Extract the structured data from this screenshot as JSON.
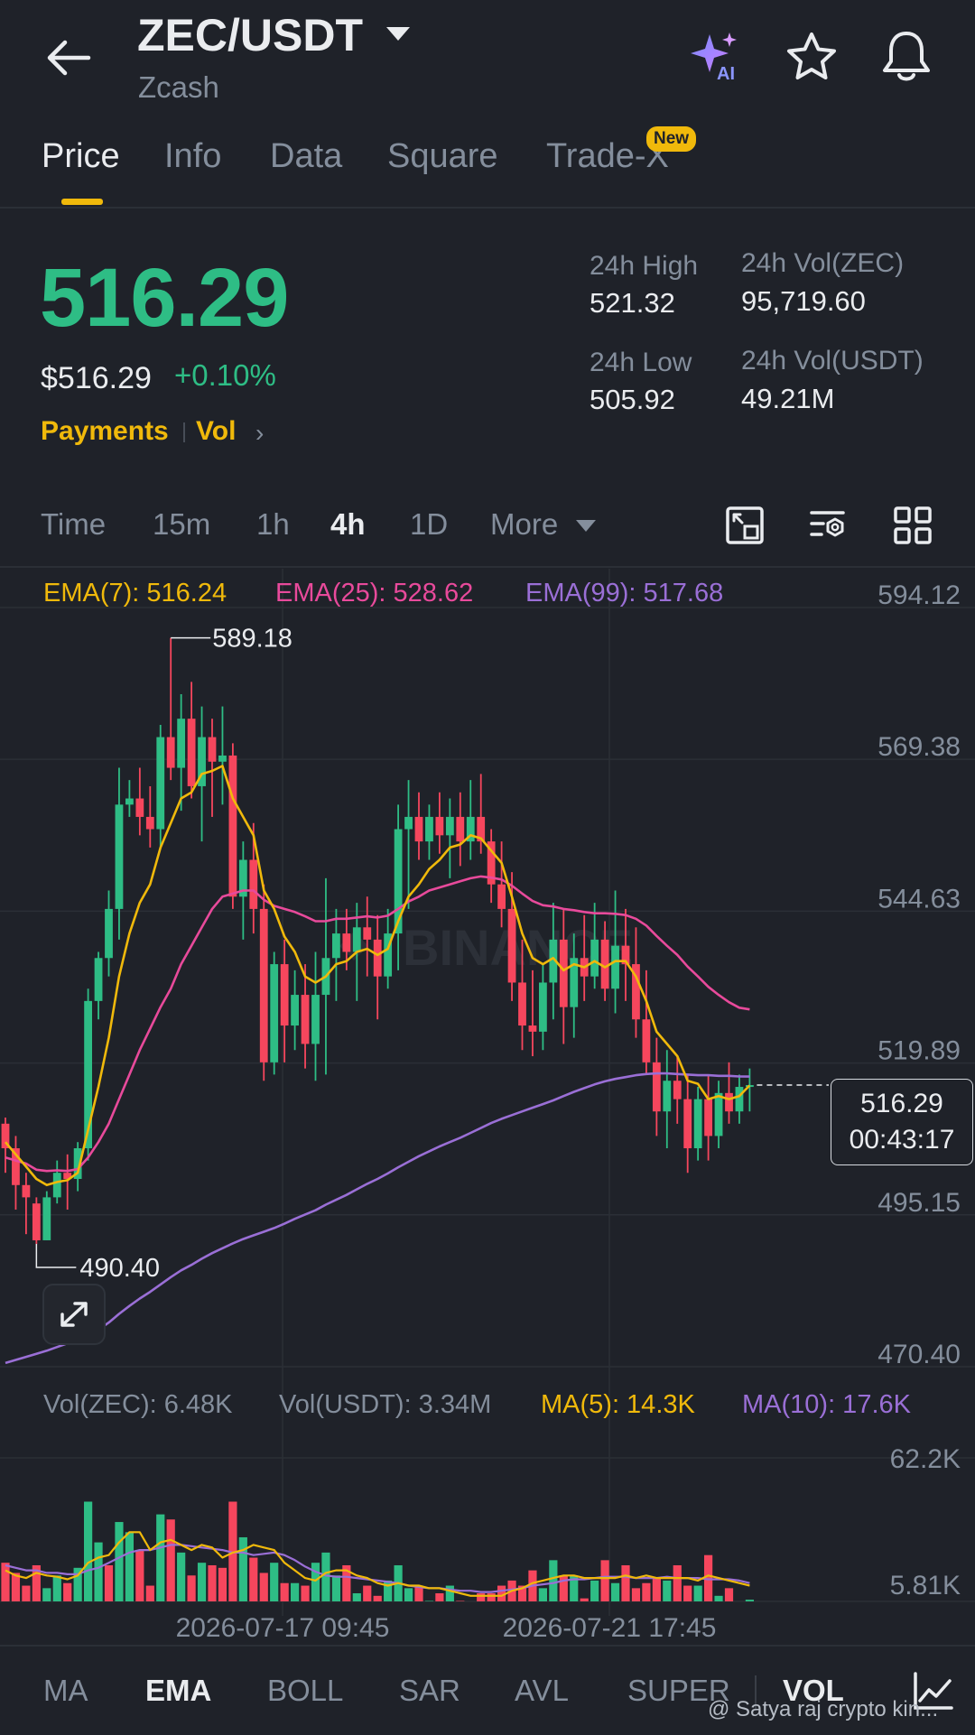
{
  "header": {
    "pair": "ZEC/USDT",
    "name": "Zcash",
    "icons": [
      "back-arrow-icon",
      "ai-sparkle-icon",
      "star-icon",
      "bell-icon"
    ]
  },
  "tabs": {
    "items": [
      "Price",
      "Info",
      "Data",
      "Square",
      "Trade-X"
    ],
    "active": "Price",
    "new_badge": "New"
  },
  "ticker": {
    "last_price": "516.29",
    "usd_price": "$516.29",
    "change_pct": "+0.10%",
    "tags": [
      "Payments",
      "Vol"
    ],
    "stats": {
      "high_label": "24h High",
      "high": "521.32",
      "low_label": "24h Low",
      "low": "505.92",
      "vol_base_label": "24h Vol(ZEC)",
      "vol_base": "95,719.60",
      "vol_quote_label": "24h Vol(USDT)",
      "vol_quote": "49.21M"
    }
  },
  "intervals": {
    "items": [
      "Time",
      "15m",
      "1h",
      "4h",
      "1D",
      "More"
    ],
    "active": "4h",
    "tools": [
      "fullscreen-icon",
      "chart-settings-icon",
      "layout-grid-icon"
    ]
  },
  "ema_legend": {
    "ema7": "EMA(7): 516.24",
    "ema25": "EMA(25): 528.62",
    "ema99": "EMA(99): 517.68"
  },
  "volume_legend": {
    "vol_base": "Vol(ZEC): 6.48K",
    "vol_quote": "Vol(USDT): 3.34M",
    "ma5": "MA(5): 14.3K",
    "ma10": "MA(10): 17.6K"
  },
  "price_box": {
    "value": "516.29",
    "countdown": "00:43:17"
  },
  "chart_data": {
    "type": "candlestick",
    "interval": "4h",
    "price_axis_ticks": [
      "594.12",
      "569.38",
      "544.63",
      "519.89",
      "495.15",
      "470.40"
    ],
    "volume_axis_ticks": [
      "62.2K",
      "5.81K"
    ],
    "time_axis_ticks": [
      "2026-07-17 09:45",
      "2026-07-21 17:45"
    ],
    "high_annotation": "589.18",
    "low_annotation": "490.40",
    "ylim": [
      470.4,
      594.12
    ],
    "volume_ylim": [
      5.81,
      62.2
    ],
    "volume_unit": "K",
    "watermark": "BINANCE",
    "colors": {
      "up": "#2ebd85",
      "down": "#f6465d",
      "ema7": "#f0b90b",
      "ema25": "#e84a9b",
      "ema99": "#9a6fd6",
      "vol_ma5": "#f0b90b",
      "vol_ma10": "#9a6fd6"
    },
    "candles": [
      [
        510,
        511,
        502,
        506
      ],
      [
        506,
        508,
        496,
        500
      ],
      [
        500,
        502,
        492,
        498
      ],
      [
        497,
        498,
        490.4,
        491
      ],
      [
        491,
        499,
        491,
        498
      ],
      [
        498,
        504,
        497,
        502
      ],
      [
        502,
        505,
        496,
        501
      ],
      [
        501,
        507,
        499,
        506
      ],
      [
        506,
        532,
        504,
        530
      ],
      [
        530,
        538,
        527,
        537
      ],
      [
        537,
        548,
        534,
        545
      ],
      [
        545,
        568,
        540,
        562
      ],
      [
        562,
        566,
        560,
        563
      ],
      [
        563,
        568,
        557,
        560
      ],
      [
        560,
        565,
        555,
        558
      ],
      [
        558,
        575,
        555,
        573
      ],
      [
        573,
        589.18,
        566,
        568
      ],
      [
        568,
        580,
        561,
        576
      ],
      [
        576,
        582,
        563,
        565
      ],
      [
        565,
        578,
        556,
        573
      ],
      [
        573,
        576,
        560,
        569
      ],
      [
        569,
        578,
        562,
        570
      ],
      [
        570,
        572,
        545,
        547
      ],
      [
        547,
        556,
        540,
        553
      ],
      [
        553,
        559,
        541,
        545
      ],
      [
        545,
        549,
        517,
        520
      ],
      [
        520,
        538,
        518,
        536
      ],
      [
        536,
        540,
        520,
        526
      ],
      [
        526,
        535,
        522,
        531
      ],
      [
        531,
        536,
        519,
        523
      ],
      [
        523,
        538,
        517,
        531
      ],
      [
        531,
        550,
        518,
        537
      ],
      [
        537,
        545,
        530,
        541
      ],
      [
        541,
        545,
        535,
        538
      ],
      [
        538,
        546,
        530,
        542
      ],
      [
        542,
        547,
        534,
        540
      ],
      [
        540,
        544,
        527,
        534
      ],
      [
        534,
        545,
        532,
        541
      ],
      [
        541,
        562,
        535,
        558
      ],
      [
        558,
        566,
        545,
        560
      ],
      [
        560,
        564,
        553,
        556
      ],
      [
        556,
        562,
        553,
        560
      ],
      [
        560,
        564,
        554,
        557
      ],
      [
        557,
        563,
        550,
        560
      ],
      [
        560,
        564,
        552,
        556
      ],
      [
        556,
        566,
        553,
        560
      ],
      [
        560,
        567,
        554,
        556
      ],
      [
        556,
        558,
        546,
        549
      ],
      [
        549,
        556,
        542,
        545
      ],
      [
        545,
        551,
        530,
        533
      ],
      [
        533,
        540,
        522,
        526
      ],
      [
        526,
        535,
        521,
        525
      ],
      [
        525,
        536,
        522,
        533
      ],
      [
        533,
        546,
        527,
        540
      ],
      [
        540,
        545,
        523,
        529
      ],
      [
        529,
        541,
        524,
        537
      ],
      [
        537,
        544,
        530,
        534
      ],
      [
        534,
        546,
        532,
        540
      ],
      [
        540,
        543,
        530,
        532
      ],
      [
        532,
        548,
        528,
        539
      ],
      [
        539,
        545,
        530,
        536
      ],
      [
        536,
        542,
        524,
        527
      ],
      [
        527,
        535,
        518,
        520
      ],
      [
        520,
        524,
        508,
        512
      ],
      [
        512,
        522,
        506,
        517
      ],
      [
        517,
        521,
        510,
        514
      ],
      [
        514,
        518,
        502,
        506
      ],
      [
        506,
        516,
        504,
        514
      ],
      [
        514,
        518,
        504,
        508
      ],
      [
        508,
        517,
        506,
        515
      ],
      [
        515,
        520,
        510,
        512
      ],
      [
        512,
        518,
        510,
        516
      ],
      [
        516,
        519,
        512,
        516.29
      ]
    ],
    "ema7": [
      507,
      505,
      503,
      501,
      500,
      500.5,
      500.8,
      502,
      509,
      516,
      524,
      534,
      541,
      546,
      549,
      555,
      559,
      563,
      564,
      567,
      567.5,
      568.3,
      563,
      560,
      557,
      548,
      545,
      540.5,
      538,
      534,
      533,
      534,
      536,
      536.5,
      538,
      538.5,
      537.5,
      538.5,
      543,
      547,
      549,
      551.5,
      553,
      555,
      555.5,
      557,
      556.5,
      554.5,
      552.5,
      547,
      541,
      537,
      536,
      537,
      535,
      536,
      535.5,
      536.5,
      535.5,
      536.5,
      536.5,
      534,
      530,
      525,
      523,
      521,
      517,
      516.5,
      514,
      514.5,
      514,
      514.5,
      516.24
    ],
    "ema25": [
      504.5,
      504,
      503.5,
      502.5,
      502.3,
      502.4,
      502.3,
      502.6,
      504.5,
      507,
      510,
      514,
      518,
      522,
      525.5,
      529,
      532,
      536,
      539,
      542,
      545,
      547,
      547.5,
      548,
      548,
      546.5,
      545.5,
      545,
      544.5,
      543.8,
      543,
      543,
      543.4,
      543.4,
      543.6,
      543.8,
      543.6,
      543.9,
      545,
      546.2,
      547,
      548,
      548.5,
      549,
      549.5,
      550,
      550.3,
      550.1,
      549.8,
      548.8,
      547.5,
      546.3,
      545.6,
      545.4,
      545,
      544.8,
      544.5,
      544.3,
      544.3,
      544.2,
      544,
      543.4,
      542.3,
      540.6,
      539,
      537.5,
      535.6,
      534,
      532.3,
      531,
      529.8,
      528.9,
      528.62
    ],
    "ema99": [
      471,
      471.5,
      472,
      472.5,
      473,
      473.6,
      474.2,
      474.8,
      475.6,
      476.4,
      477.6,
      479,
      480.3,
      481.5,
      482.6,
      483.8,
      485,
      486.1,
      487,
      488,
      488.9,
      489.7,
      490.5,
      491.2,
      491.8,
      492.4,
      493,
      493.7,
      494.5,
      495.2,
      495.9,
      496.8,
      497.6,
      498.4,
      499.3,
      500.2,
      501,
      501.9,
      502.9,
      503.8,
      504.7,
      505.5,
      506.3,
      507,
      507.7,
      508.5,
      509.3,
      510.1,
      510.8,
      511.4,
      512,
      512.6,
      513.2,
      513.8,
      514.5,
      515.2,
      515.8,
      516.4,
      516.9,
      517.3,
      517.6,
      517.9,
      518.1,
      518.2,
      518.2,
      518.1,
      518,
      517.9,
      517.9,
      517.8,
      517.8,
      517.7,
      517.68
    ],
    "volume": [
      21,
      17,
      12,
      20,
      11,
      16,
      13,
      19,
      45,
      29,
      20,
      37,
      33,
      26,
      12,
      40,
      38,
      25,
      16,
      21,
      20,
      19,
      45,
      31,
      23,
      17,
      21,
      13,
      13,
      12,
      21,
      25,
      16,
      20,
      9,
      12,
      8,
      14,
      20,
      11,
      12,
      6,
      9,
      12,
      6,
      5,
      9,
      9,
      12,
      14,
      12,
      18,
      11,
      22,
      16,
      16,
      7,
      14,
      22,
      13,
      20,
      11,
      13,
      15,
      14,
      20,
      12,
      12,
      24,
      8,
      11,
      5,
      6.48
    ],
    "volume_up": [
      false,
      false,
      false,
      false,
      true,
      true,
      false,
      true,
      true,
      true,
      false,
      true,
      true,
      false,
      false,
      true,
      false,
      true,
      false,
      true,
      false,
      false,
      false,
      true,
      false,
      false,
      true,
      false,
      true,
      false,
      true,
      true,
      true,
      false,
      true,
      false,
      false,
      true,
      true,
      true,
      false,
      true,
      false,
      true,
      false,
      true,
      false,
      false,
      false,
      false,
      false,
      false,
      true,
      true,
      false,
      true,
      false,
      true,
      false,
      true,
      false,
      false,
      false,
      false,
      true,
      false,
      false,
      true,
      false,
      true,
      false,
      true,
      true
    ],
    "vol_ma5": [
      18,
      16,
      15,
      17,
      16,
      15.5,
      14.5,
      16,
      21,
      23,
      24,
      29,
      33,
      33,
      26,
      29,
      30,
      28,
      26,
      28,
      27,
      23,
      25,
      26,
      28,
      27,
      26,
      21,
      18,
      15,
      14,
      17,
      18,
      18,
      16,
      15,
      13,
      12,
      13,
      12,
      12,
      11,
      11,
      10,
      9,
      8,
      8,
      8,
      8,
      10,
      11,
      13,
      14,
      15,
      16,
      16,
      15,
      15,
      15,
      15,
      16,
      15,
      16,
      15,
      15,
      15,
      15,
      14,
      16,
      15,
      14,
      13,
      12
    ],
    "vol_ma10": [
      20,
      19,
      18,
      18,
      17,
      17,
      16.5,
      16.5,
      18,
      19,
      21,
      23,
      25,
      26,
      26,
      27,
      28,
      28,
      27.5,
      27,
      26.5,
      26,
      25,
      25,
      24,
      24.5,
      25,
      24,
      22,
      19.5,
      17.5,
      16,
      15.5,
      15.5,
      15,
      14.5,
      14,
      13.5,
      13,
      12,
      11.5,
      11,
      11,
      10.5,
      10,
      10,
      9.5,
      9.5,
      10,
      10.5,
      11,
      12,
      12.5,
      13,
      14,
      14.5,
      14.5,
      15,
      15.5,
      15.5,
      15.5,
      15,
      15,
      15,
      15.5,
      15,
      15,
      15,
      14.5,
      14.5,
      14.5,
      14,
      13
    ]
  },
  "indicators": {
    "items": [
      "MA",
      "EMA",
      "BOLL",
      "SAR",
      "AVL",
      "SUPER",
      "VOL"
    ],
    "active": [
      "EMA",
      "VOL"
    ],
    "icon": "chart-line-icon"
  },
  "watermark": "@ Satya raj crypto kin..."
}
